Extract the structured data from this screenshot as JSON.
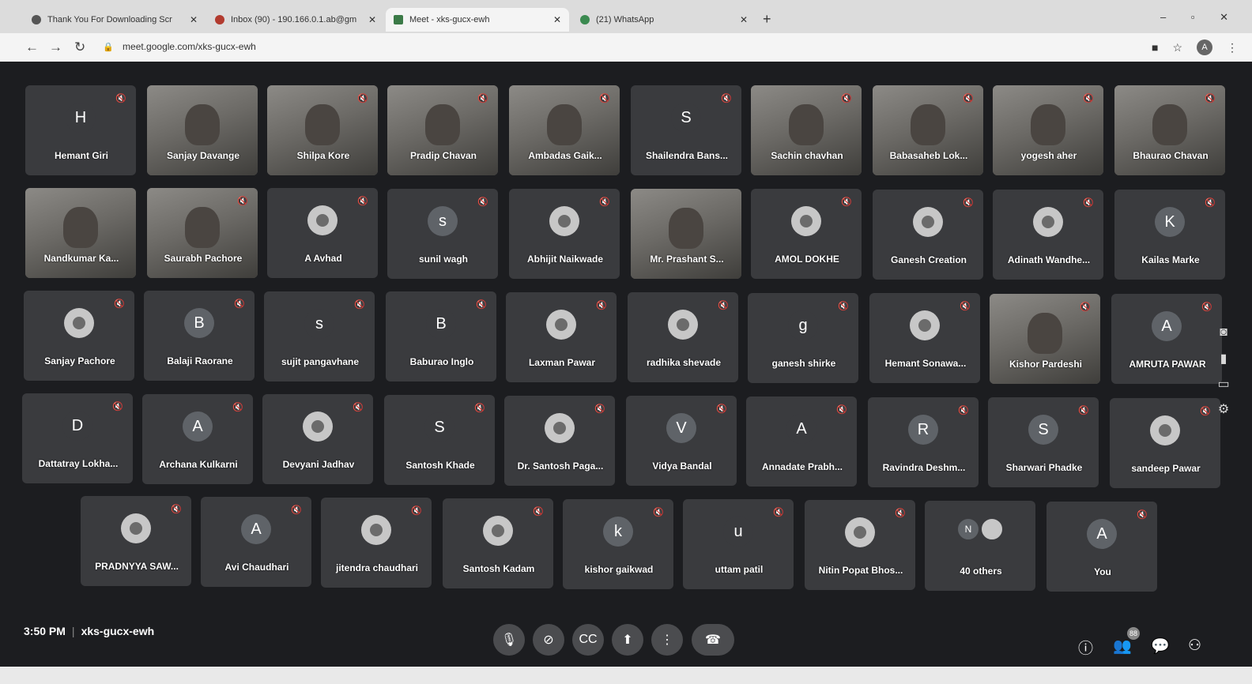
{
  "browser": {
    "tabs": [
      {
        "title": "Thank You For Downloading Scr",
        "icon": "download-page-favicon",
        "close": "✕"
      },
      {
        "title": "Inbox (90) - 190.166.0.1.ab@gm",
        "icon": "gmail-icon",
        "close": "✕"
      },
      {
        "title": "Meet - xks-gucx-ewh",
        "icon": "meet-icon",
        "close": "✕"
      },
      {
        "title": "(21) WhatsApp",
        "icon": "whatsapp-icon",
        "close": "✕"
      }
    ],
    "new_tab": "+",
    "window_controls": "– ▫ ✕",
    "url": "meet.google.com/xks-gucx-ewh",
    "profile_initial": "A",
    "nav": {
      "back": "←",
      "forward": "→",
      "reload": "↻"
    }
  },
  "participants": [
    {
      "name": "Hemant Giri",
      "initial": "H",
      "avatar_color": "#3a3b3e",
      "kind": "letter"
    },
    {
      "name": "Sanjay Davange",
      "kind": "video"
    },
    {
      "name": "Shilpa Kore",
      "kind": "video"
    },
    {
      "name": "Pradip Chavan",
      "kind": "video"
    },
    {
      "name": "Ambadas Gaik...",
      "kind": "video"
    },
    {
      "name": "Shailendra Bans...",
      "initial": "S",
      "avatar_color": "#3a3b3e",
      "kind": "letter"
    },
    {
      "name": "Sachin chavhan",
      "kind": "video"
    },
    {
      "name": "Babasaheb Lok...",
      "kind": "video"
    },
    {
      "name": "yogesh aher",
      "kind": "video"
    },
    {
      "name": "Bhaurao Chavan",
      "kind": "video"
    },
    {
      "name": "Nandkumar Ka...",
      "kind": "video"
    },
    {
      "name": "Saurabh Pachore",
      "kind": "video"
    },
    {
      "name": "A Avhad",
      "kind": "image"
    },
    {
      "name": "sunil wagh",
      "initial": "s",
      "avatar_color": "#5f6368",
      "kind": "letter"
    },
    {
      "name": "Abhijit Naikwade",
      "kind": "image"
    },
    {
      "name": "Mr. Prashant S...",
      "kind": "video"
    },
    {
      "name": "AMOL DOKHE",
      "kind": "image"
    },
    {
      "name": "Ganesh Creation",
      "kind": "image"
    },
    {
      "name": "Adinath Wandhe...",
      "kind": "image"
    },
    {
      "name": "Kailas Marke",
      "initial": "K",
      "avatar_color": "#5f6368",
      "kind": "letter"
    },
    {
      "name": "Sanjay Pachore",
      "kind": "image"
    },
    {
      "name": "Balaji Raorane",
      "initial": "B",
      "avatar_color": "#5f6368",
      "kind": "letter"
    },
    {
      "name": "sujit pangavhane",
      "initial": "s",
      "avatar_color": "#3a3b3e",
      "kind": "letter"
    },
    {
      "name": "Baburao Inglo",
      "initial": "B",
      "avatar_color": "#3a3b3e",
      "kind": "letter"
    },
    {
      "name": "Laxman Pawar",
      "kind": "image"
    },
    {
      "name": "radhika shevade",
      "kind": "image"
    },
    {
      "name": "ganesh shirke",
      "initial": "g",
      "avatar_color": "#3a3b3e",
      "kind": "letter"
    },
    {
      "name": "Hemant Sonawa...",
      "kind": "image"
    },
    {
      "name": "Kishor Pardeshi",
      "kind": "video"
    },
    {
      "name": "AMRUTA PAWAR",
      "initial": "A",
      "avatar_color": "#5f6368",
      "kind": "letter"
    },
    {
      "name": "Dattatray Lokha...",
      "initial": "D",
      "avatar_color": "#3a3b3e",
      "kind": "letter"
    },
    {
      "name": "Archana Kulkarni",
      "initial": "A",
      "avatar_color": "#5f6368",
      "kind": "letter"
    },
    {
      "name": "Devyani Jadhav",
      "kind": "image"
    },
    {
      "name": "Santosh Khade",
      "initial": "S",
      "avatar_color": "#3a3b3e",
      "kind": "letter"
    },
    {
      "name": "Dr. Santosh Paga...",
      "kind": "image"
    },
    {
      "name": "Vidya Bandal",
      "initial": "V",
      "avatar_color": "#5f6368",
      "kind": "letter"
    },
    {
      "name": "Annadate Prabh...",
      "initial": "A",
      "avatar_color": "#3a3b3e",
      "kind": "letter"
    },
    {
      "name": "Ravindra Deshm...",
      "initial": "R",
      "avatar_color": "#5f6368",
      "kind": "letter"
    },
    {
      "name": "Sharwari Phadke",
      "initial": "S",
      "avatar_color": "#5f6368",
      "kind": "letter"
    },
    {
      "name": "sandeep Pawar",
      "kind": "image"
    },
    {
      "name": "PRADNYYA SAW...",
      "kind": "image"
    },
    {
      "name": "Avi Chaudhari",
      "initial": "A",
      "avatar_color": "#5f6368",
      "kind": "letter"
    },
    {
      "name": "jitendra chaudhari",
      "kind": "image"
    },
    {
      "name": "Santosh Kadam",
      "kind": "image"
    },
    {
      "name": "kishor gaikwad",
      "initial": "k",
      "avatar_color": "#5f6368",
      "kind": "letter"
    },
    {
      "name": "uttam patil",
      "initial": "u",
      "avatar_color": "#3a3b3e",
      "kind": "letter"
    },
    {
      "name": "Nitin Popat Bhos...",
      "kind": "image"
    },
    {
      "name": "40 others",
      "kind": "others",
      "initials": [
        "N",
        ""
      ]
    },
    {
      "name": "You",
      "initial": "A",
      "avatar_color": "#5f6368",
      "kind": "letter"
    }
  ],
  "meeting": {
    "time": "3:50 PM",
    "code": "xks-gucx-ewh",
    "participant_count": "88"
  },
  "controls": [
    {
      "name": "mic-off-button",
      "icon": "mic-off-icon",
      "glyph": "🎙"
    },
    {
      "name": "camera-off-button",
      "icon": "camera-off-icon",
      "glyph": "⊘"
    },
    {
      "name": "captions-button",
      "icon": "captions-icon",
      "glyph": "CC"
    },
    {
      "name": "present-button",
      "icon": "present-icon",
      "glyph": "⬆"
    },
    {
      "name": "more-options-button",
      "icon": "more-vert-icon",
      "glyph": "⋮"
    },
    {
      "name": "leave-call-button",
      "icon": "call-end-icon",
      "glyph": "☎"
    }
  ],
  "right_controls": [
    {
      "name": "meeting-details-button",
      "icon": "info-icon",
      "glyph": "ⓘ"
    },
    {
      "name": "people-button",
      "icon": "people-icon",
      "glyph": "👥"
    },
    {
      "name": "chat-button",
      "icon": "chat-icon",
      "glyph": "💬"
    },
    {
      "name": "activities-button",
      "icon": "activities-icon",
      "glyph": "⚇"
    }
  ],
  "side_tools": [
    "camera-icon",
    "record-icon",
    "screen-icon",
    "gear-icon"
  ],
  "mute_glyph": "🔇"
}
